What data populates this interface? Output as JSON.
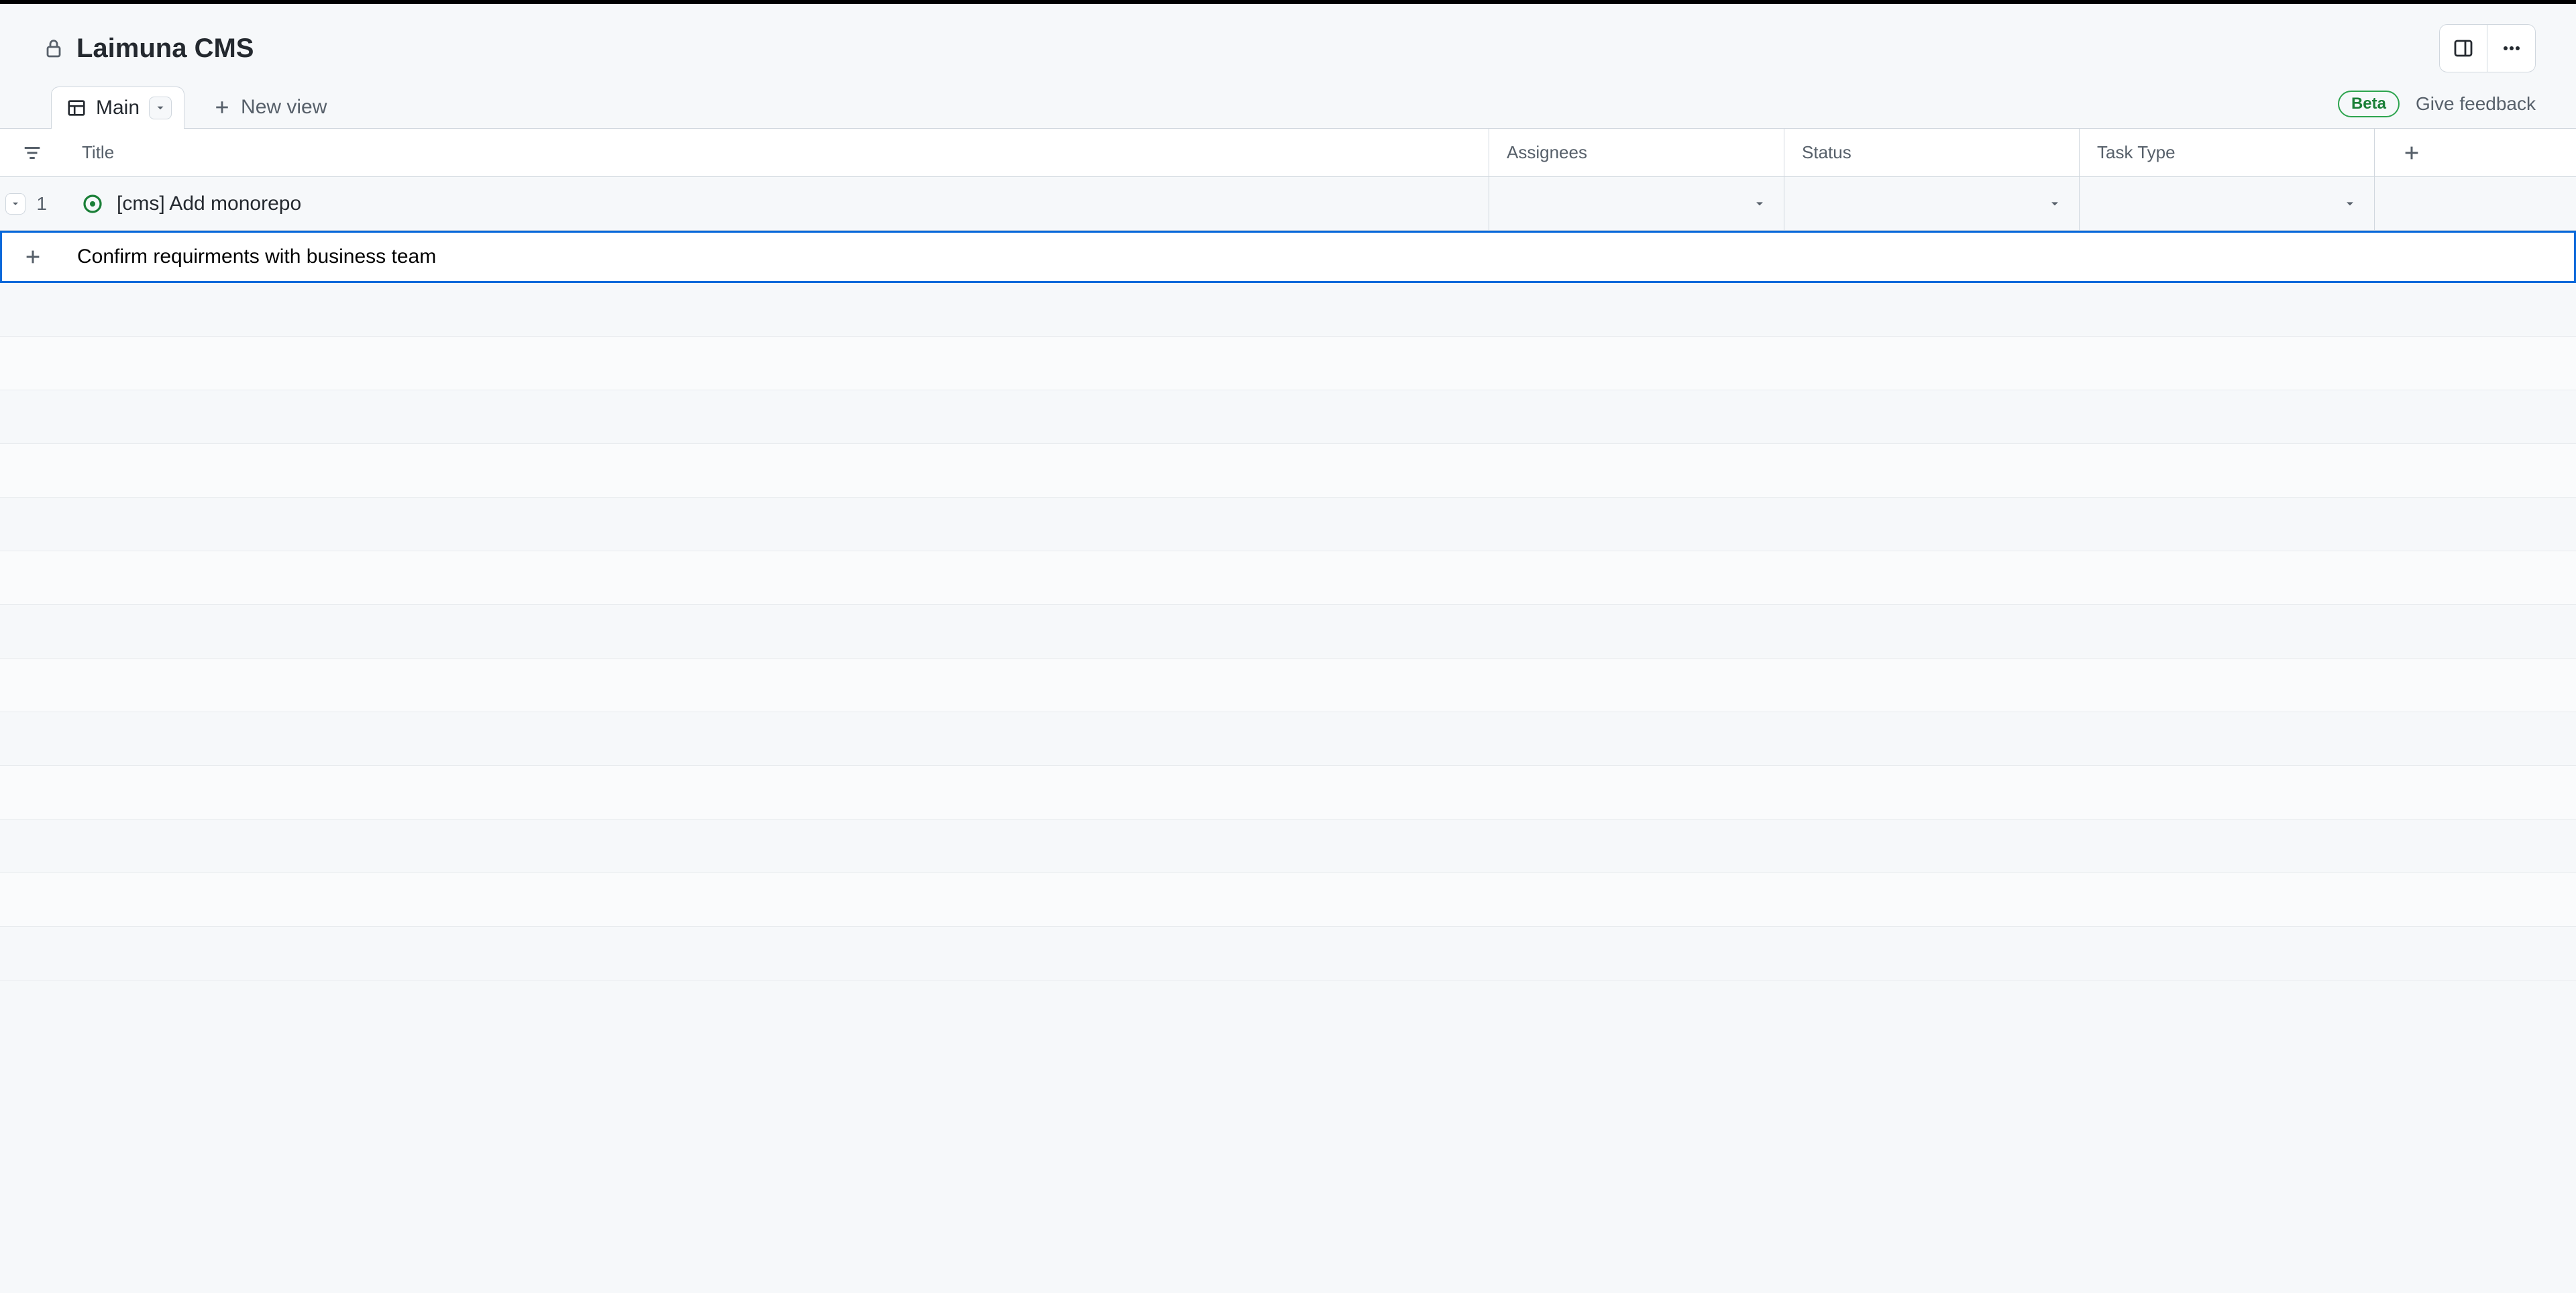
{
  "header": {
    "title": "Laimuna CMS"
  },
  "tabs": {
    "active": "Main",
    "new_view_label": "New view"
  },
  "badges": {
    "beta": "Beta",
    "feedback": "Give feedback"
  },
  "columns": {
    "title": "Title",
    "assignees": "Assignees",
    "status": "Status",
    "task_type": "Task Type"
  },
  "rows": [
    {
      "num": "1",
      "title": "[cms] Add monorepo",
      "assignees": "",
      "status": "",
      "task_type": ""
    }
  ],
  "new_item": {
    "value": "Confirm requirments with business team"
  }
}
